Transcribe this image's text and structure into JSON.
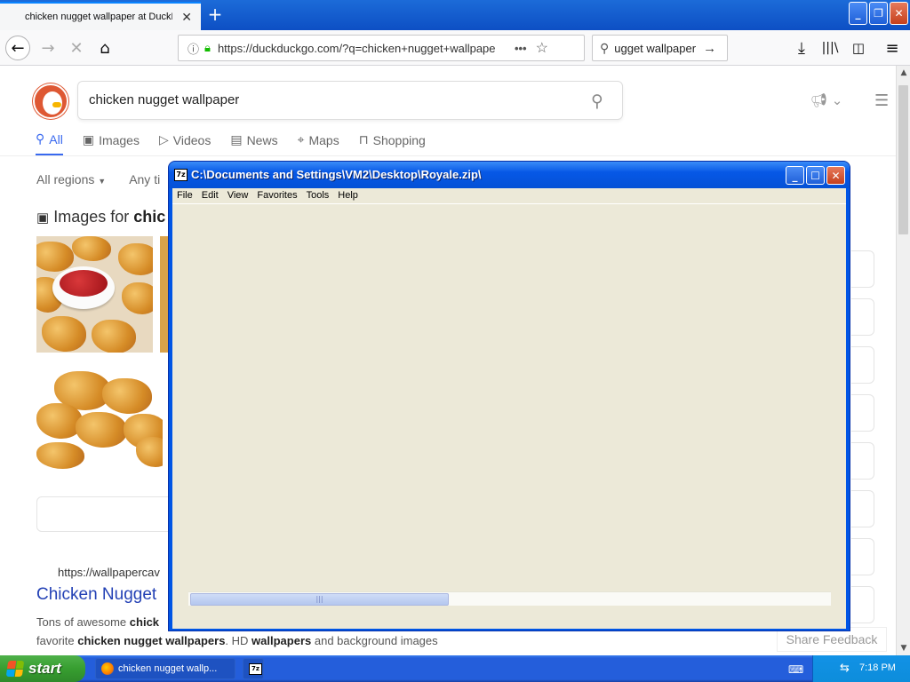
{
  "browser": {
    "tab_title": "chicken nugget wallpaper at DuckD",
    "url": "https://duckduckgo.com/?q=chicken+nugget+wallpape",
    "search_value": "ugget wallpaper"
  },
  "ddg": {
    "query": "chicken nugget wallpaper",
    "tabs": [
      {
        "label": "All",
        "icon": "search-icon"
      },
      {
        "label": "Images",
        "icon": "image-icon"
      },
      {
        "label": "Videos",
        "icon": "play-icon"
      },
      {
        "label": "News",
        "icon": "newspaper-icon"
      },
      {
        "label": "Maps",
        "icon": "map-pin-icon"
      },
      {
        "label": "Shopping",
        "icon": "shopping-bag-icon"
      }
    ],
    "filters": {
      "regions": "All regions",
      "time": "Any ti"
    },
    "images_heading_prefix": "Images for",
    "images_heading_query": "chic",
    "result": {
      "url": "https://wallpapercav",
      "title": "Chicken Nugget",
      "snippet_line1_a": "Tons of awesome",
      "snippet_line1_b": "chick",
      "snippet_line2_a": "favorite",
      "snippet_line2_b": "chicken nugget wallpapers",
      "snippet_line2_c": ". HD",
      "snippet_line2_d": "wallpapers",
      "snippet_line2_e": "and background images"
    },
    "share_feedback": "Share Feedback"
  },
  "zip": {
    "app_icon": "7z",
    "title": "C:\\Documents and Settings\\VM2\\Desktop\\Royale.zip\\",
    "menu": [
      "File",
      "Edit",
      "View",
      "Favorites",
      "Tools",
      "Help"
    ]
  },
  "taskbar": {
    "start": "start",
    "items": [
      {
        "label": "chicken nugget wallp..."
      },
      {
        "label": ""
      }
    ],
    "zip_icon": "7z",
    "clock": "7:18 PM"
  }
}
